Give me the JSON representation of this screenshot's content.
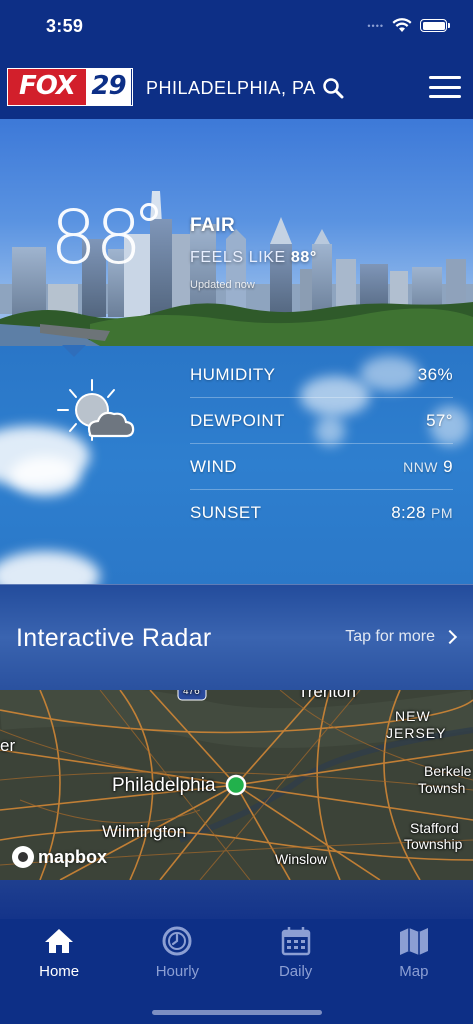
{
  "status_bar": {
    "time": "3:59",
    "signal": "••••"
  },
  "header": {
    "logo_fox": "FOX",
    "logo_number": "29",
    "location": "PHILADELPHIA, PA",
    "search_icon": "search-icon",
    "menu_icon": "hamburger-menu-icon"
  },
  "current": {
    "temperature": "88",
    "condition": "FAIR",
    "feels_like_label": "FEELS LIKE",
    "feels_like_value": "88°",
    "updated": "Updated now",
    "icon": "partly-cloudy-icon"
  },
  "stats": [
    {
      "label": "HUMIDITY",
      "value": "36%",
      "unit": ""
    },
    {
      "label": "DEWPOINT",
      "value": "57°",
      "unit": ""
    },
    {
      "label": "WIND",
      "value": "9",
      "unit": "NNW"
    },
    {
      "label": "SUNSET",
      "value": "8:28",
      "unit": "PM"
    }
  ],
  "radar": {
    "title": "Interactive Radar",
    "more": "Tap for more"
  },
  "map": {
    "labels": {
      "trenton": "Trenton",
      "new_jersey_1": "NEW",
      "new_jersey_2": "JERSEY",
      "philadelphia": "Philadelphia",
      "berkeley_1": "Berkele",
      "berkeley_2": "Townsh",
      "wilmington": "Wilmington",
      "stafford_1": "Stafford",
      "stafford_2": "Township",
      "winslow": "Winslow",
      "left_edge": "er",
      "shield": "476"
    },
    "attribution": "mapbox",
    "marker_color": "#22b14c"
  },
  "tabs": [
    {
      "label": "Home",
      "icon": "home-icon",
      "active": true
    },
    {
      "label": "Hourly",
      "icon": "clock-icon",
      "active": false
    },
    {
      "label": "Daily",
      "icon": "calendar-icon",
      "active": false
    },
    {
      "label": "Map",
      "icon": "map-icon",
      "active": false
    }
  ],
  "colors": {
    "brand_blue": "#0d2f86",
    "fox_red": "#d21f2b",
    "inactive_tab": "#8c9fd3"
  }
}
